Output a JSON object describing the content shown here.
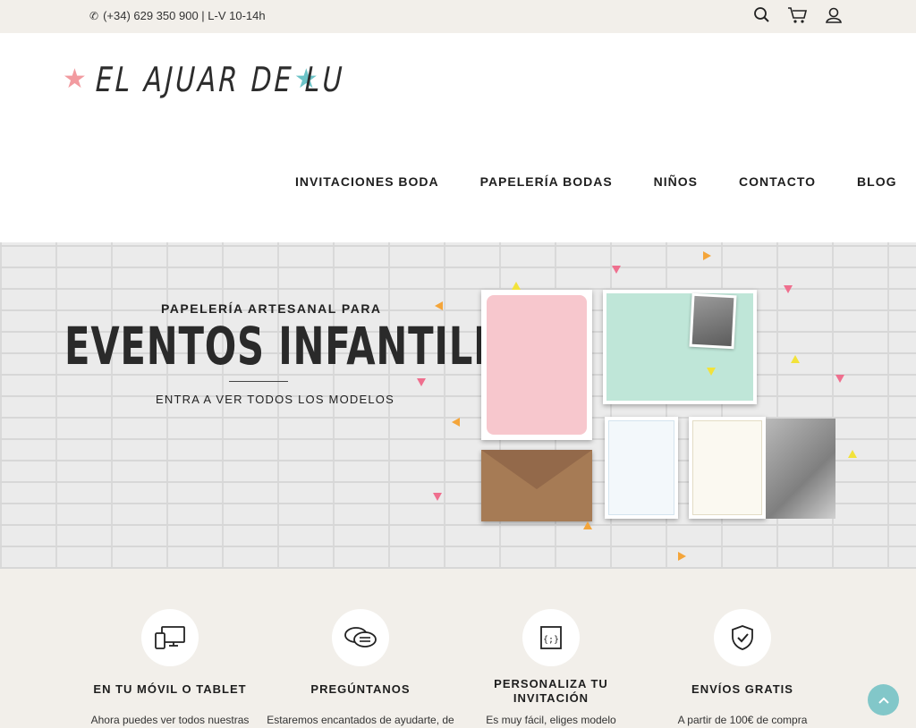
{
  "topbar": {
    "phone_text": "(+34) 629 350 900 | L-V 10-14h",
    "icons": [
      "phone-icon",
      "search-icon",
      "cart-icon",
      "user-icon"
    ]
  },
  "header": {
    "logo_text": "EL AJUAR DE LU",
    "logo_colors": {
      "left_star": "#f29ba0",
      "right_star": "#6cc3c7"
    },
    "nav": [
      {
        "label": "INVITACIONES BODA"
      },
      {
        "label": "PAPELERÍA BODAS"
      },
      {
        "label": "NIÑOS"
      },
      {
        "label": "CONTACTO"
      },
      {
        "label": "BLOG"
      }
    ]
  },
  "hero": {
    "subtitle": "PAPELERÍA ARTESANAL PARA",
    "title": "EVENTOS INFANTILES",
    "link": "ENTRA A VER TODOS LOS MODELOS"
  },
  "features": [
    {
      "icon": "devices-icon",
      "title": "EN TU MÓVIL O TABLET",
      "text": "Ahora puedes ver todos nuestras colecciones desde"
    },
    {
      "icon": "chat-icon",
      "title": "PREGÚNTANOS",
      "text": "Estaremos encantados de ayudarte, de lunes a viernes de"
    },
    {
      "icon": "code-icon",
      "title": "PERSONALIZA TU INVITACIÓN",
      "text": "Es muy fácil, eliges modelo"
    },
    {
      "icon": "shield-check-icon",
      "title": "ENVÍOS GRATIS",
      "text": "A partir de 100€ de compra"
    }
  ],
  "colors": {
    "topbar_bg": "#f2efea",
    "features_bg": "#f2efea",
    "accent_teal": "#82c7c9"
  }
}
